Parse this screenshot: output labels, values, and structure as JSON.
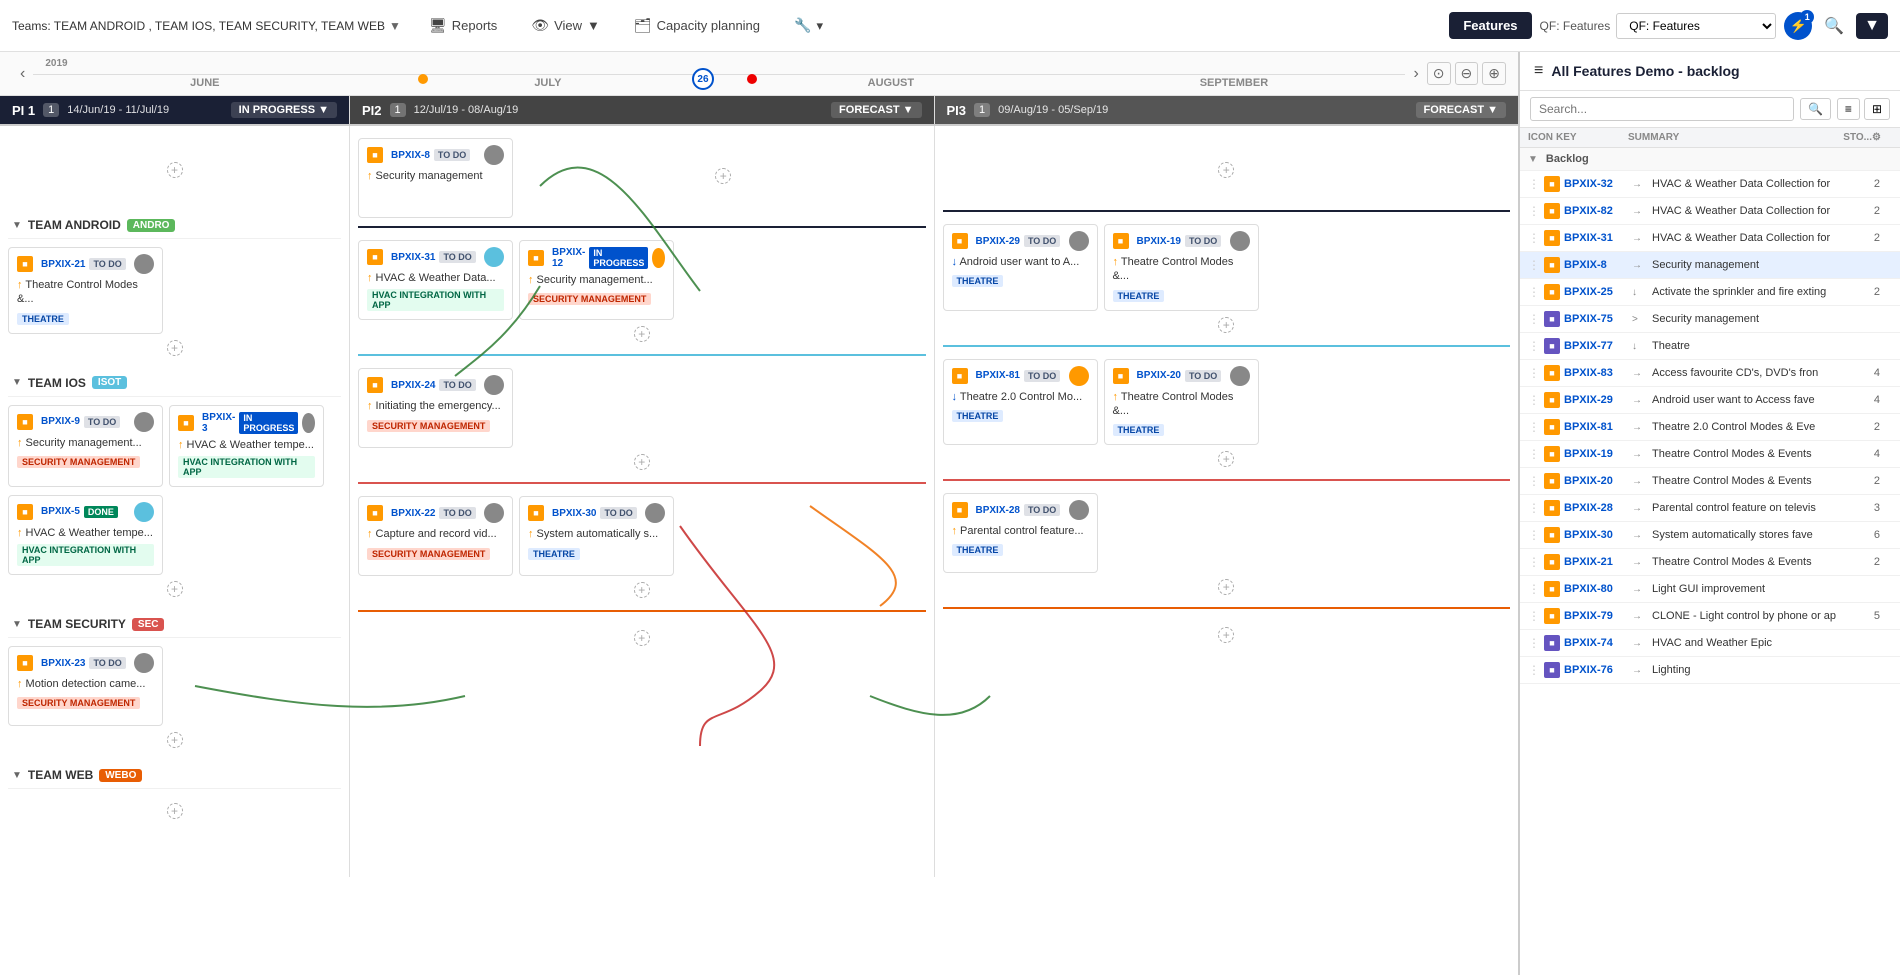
{
  "topbar": {
    "teams_label": "Teams: TEAM ANDROID , TEAM IOS, TEAM SECURITY, TEAM WEB",
    "reports_label": "Reports",
    "view_label": "View",
    "capacity_label": "Capacity planning",
    "features_label": "Features",
    "qf_label": "QF: Features",
    "badge_count": "1",
    "lightning": "⚡",
    "search": "🔍",
    "arrow": "▼"
  },
  "timeline": {
    "prev": "‹",
    "next": "›",
    "months": [
      {
        "label": "JUNE",
        "year": "2019"
      },
      {
        "label": "JULY",
        "year": ""
      },
      {
        "label": "AUGUST",
        "year": ""
      },
      {
        "label": "SEPTEMBER",
        "year": ""
      }
    ],
    "dot26": "26"
  },
  "pi_headers": [
    {
      "id": "PI1",
      "num": "PI 1",
      "dates": "14/Jun/19 - 11/Jul/19",
      "count": "1",
      "status": "IN PROGRESS"
    },
    {
      "id": "PI2",
      "num": "PI2",
      "dates": "12/Jul/19 - 08/Aug/19",
      "count": "1",
      "status": "FORECAST"
    },
    {
      "id": "PI3",
      "num": "PI3",
      "dates": "09/Aug/19 - 05/Sep/19",
      "count": "1",
      "status": "FORECAST"
    }
  ],
  "teams": [
    {
      "name": "TEAM ANDROID",
      "tag": "ANDRO",
      "tag_class": "tag-andro",
      "pi1_cards": [
        {
          "key": "BPXIX-21",
          "status": "TO DO",
          "status_class": "status-todo",
          "title": "Theatre Control Modes &...",
          "label": "THEATRE",
          "label_class": "theatre",
          "avatar_color": "#888",
          "icon": "↑"
        }
      ],
      "pi2_cards": [
        {
          "key": "BPXIX-31",
          "status": "TO DO",
          "status_class": "status-todo",
          "title": "HVAC & Weather Data...",
          "label": "HVAC INTEGRATION WITH APP",
          "label_class": "hvac",
          "avatar_color": "#5bc0de",
          "icon": "↑"
        },
        {
          "key": "BPXIX-12",
          "status": "IN PROGRESS",
          "status_class": "status-inprogress",
          "title": "Security management...",
          "label": "SECURITY MANAGEMENT",
          "label_class": "sec",
          "avatar_color": "#f90",
          "icon": "↑"
        }
      ],
      "pi3_cards": [
        {
          "key": "BPXIX-29",
          "status": "TO DO",
          "status_class": "status-todo",
          "title": "Android user want to A...",
          "label": "THEATRE",
          "label_class": "theatre",
          "avatar_color": "#888",
          "icon": "↓"
        },
        {
          "key": "BPXIX-19",
          "status": "TO DO",
          "status_class": "status-todo",
          "title": "Theatre Control Modes &...",
          "label": "THEATRE",
          "label_class": "theatre",
          "avatar_color": "#888",
          "icon": "↑"
        }
      ]
    },
    {
      "name": "TEAM IOS",
      "tag": "ISOT",
      "tag_class": "tag-isot",
      "pi1_cards": [
        {
          "key": "BPXIX-9",
          "status": "TO DO",
          "status_class": "status-todo",
          "title": "Security management...",
          "label": "SECURITY MANAGEMENT",
          "label_class": "sec",
          "avatar_color": "#888",
          "icon": "↑"
        },
        {
          "key": "BPXIX-3",
          "status": "IN PROGRESS",
          "status_class": "status-inprogress",
          "title": "HVAC & Weather tempe...",
          "label": "HVAC INTEGRATION WITH APP",
          "label_class": "hvac",
          "avatar_color": "#888",
          "icon": "↑"
        },
        {
          "key": "BPXIX-5",
          "status": "DONE",
          "status_class": "status-done",
          "title": "HVAC & Weather tempe...",
          "label": "HVAC INTEGRATION WITH APP",
          "label_class": "hvac",
          "avatar_color": "#5bc0de",
          "icon": "↑"
        }
      ],
      "pi2_cards": [
        {
          "key": "BPXIX-24",
          "status": "TO DO",
          "status_class": "status-todo",
          "title": "Initiating the emergency...",
          "label": "SECURITY MANAGEMENT",
          "label_class": "sec",
          "avatar_color": "#888",
          "icon": "↑"
        }
      ],
      "pi3_cards": [
        {
          "key": "BPXIX-81",
          "status": "TO DO",
          "status_class": "status-todo",
          "title": "Theatre 2.0 Control Mo...",
          "label": "THEATRE",
          "label_class": "theatre",
          "avatar_color": "#f90",
          "icon": "↓"
        },
        {
          "key": "BPXIX-20",
          "status": "TO DO",
          "status_class": "status-todo",
          "title": "Theatre Control Modes &...",
          "label": "THEATRE",
          "label_class": "theatre",
          "avatar_color": "#888",
          "icon": "↑"
        }
      ]
    },
    {
      "name": "TEAM SECURITY",
      "tag": "SEC",
      "tag_class": "tag-sec",
      "pi1_cards": [
        {
          "key": "BPXIX-23",
          "status": "TO DO",
          "status_class": "status-todo",
          "title": "Motion detection came...",
          "label": "SECURITY MANAGEMENT",
          "label_class": "sec",
          "avatar_color": "#888",
          "icon": "↑"
        }
      ],
      "pi2_cards": [
        {
          "key": "BPXIX-22",
          "status": "TO DO",
          "status_class": "status-todo",
          "title": "Capture and record vid...",
          "label": "SECURITY MANAGEMENT",
          "label_class": "sec",
          "avatar_color": "#888",
          "icon": "↑"
        },
        {
          "key": "BPXIX-30",
          "status": "TO DO",
          "status_class": "status-todo",
          "title": "System automatically s...",
          "label": "THEATRE",
          "label_class": "theatre",
          "avatar_color": "#888",
          "icon": "↑"
        }
      ],
      "pi3_cards": [
        {
          "key": "BPXIX-28",
          "status": "TO DO",
          "status_class": "status-todo",
          "title": "Parental control feature...",
          "label": "THEATRE",
          "label_class": "theatre",
          "avatar_color": "#888",
          "icon": "↑"
        }
      ]
    },
    {
      "name": "TEAM WEB",
      "tag": "WEBO",
      "tag_class": "tag-webo",
      "pi1_cards": [],
      "pi2_cards": [],
      "pi3_cards": []
    }
  ],
  "unscheduled_pi2": {
    "key": "BPXIX-8",
    "status": "TO DO",
    "status_class": "status-todo",
    "title": "Security management",
    "avatar_color": "#888",
    "icon": "↑"
  },
  "sidebar": {
    "title": "All Features Demo - backlog",
    "search_placeholder": "Search...",
    "columns": [
      "ICON",
      "KEY",
      "SUMMARY",
      "STO...",
      "⚙"
    ],
    "groups": [
      {
        "type": "group",
        "label": "Backlog",
        "chevron": "▼"
      },
      {
        "type": "row",
        "icon_class": "icon-orange",
        "key": "BPXIX-32",
        "arrow": "→",
        "summary": "HVAC & Weather Data Collection for",
        "sto": "2"
      },
      {
        "type": "row",
        "icon_class": "icon-orange",
        "key": "BPXIX-82",
        "arrow": "→",
        "summary": "HVAC & Weather Data Collection for",
        "sto": "2"
      },
      {
        "type": "row",
        "icon_class": "icon-orange",
        "key": "BPXIX-31",
        "arrow": "→",
        "summary": "HVAC & Weather Data Collection for",
        "sto": "2"
      },
      {
        "type": "row",
        "icon_class": "icon-orange",
        "key": "BPXIX-8",
        "arrow": "→",
        "summary": "Security management",
        "sto": ""
      },
      {
        "type": "row",
        "icon_class": "icon-orange",
        "key": "BPXIX-25",
        "arrow": "↓",
        "summary": "Activate the sprinkler and fire exting",
        "sto": "2"
      },
      {
        "type": "row",
        "icon_class": "icon-purple",
        "key": "BPXIX-75",
        "arrow": ">",
        "summary": "Security management",
        "sto": ""
      },
      {
        "type": "row",
        "icon_class": "icon-purple",
        "key": "BPXIX-77",
        "arrow": "↓",
        "summary": "Theatre",
        "sto": ""
      },
      {
        "type": "row",
        "icon_class": "icon-orange",
        "key": "BPXIX-83",
        "arrow": "→",
        "summary": "Access favourite CD's, DVD's fron",
        "sto": "4"
      },
      {
        "type": "row",
        "icon_class": "icon-orange",
        "key": "BPXIX-29",
        "arrow": "→",
        "summary": "Android user want to Access fave",
        "sto": "4"
      },
      {
        "type": "row",
        "icon_class": "icon-orange",
        "key": "BPXIX-81",
        "arrow": "→",
        "summary": "Theatre 2.0 Control Modes & Eve",
        "sto": "2"
      },
      {
        "type": "row",
        "icon_class": "icon-orange",
        "key": "BPXIX-19",
        "arrow": "→",
        "summary": "Theatre Control Modes & Events",
        "sto": "4"
      },
      {
        "type": "row",
        "icon_class": "icon-orange",
        "key": "BPXIX-20",
        "arrow": "→",
        "summary": "Theatre Control Modes & Events",
        "sto": "2"
      },
      {
        "type": "row",
        "icon_class": "icon-orange",
        "key": "BPXIX-28",
        "arrow": "→",
        "summary": "Parental control feature on televis",
        "sto": "3"
      },
      {
        "type": "row",
        "icon_class": "icon-orange",
        "key": "BPXIX-30",
        "arrow": "→",
        "summary": "System automatically stores fave",
        "sto": "6"
      },
      {
        "type": "row",
        "icon_class": "icon-orange",
        "key": "BPXIX-21",
        "arrow": "→",
        "summary": "Theatre Control Modes & Events",
        "sto": "2"
      },
      {
        "type": "row",
        "icon_class": "icon-orange",
        "key": "BPXIX-80",
        "arrow": "→",
        "summary": "Light GUI improvement",
        "sto": ""
      },
      {
        "type": "row",
        "icon_class": "icon-orange",
        "key": "BPXIX-79",
        "arrow": "→",
        "summary": "CLONE - Light control by phone or ap",
        "sto": "5"
      },
      {
        "type": "row",
        "icon_class": "icon-purple",
        "key": "BPXIX-74",
        "arrow": "→",
        "summary": "HVAC and Weather Epic",
        "sto": ""
      },
      {
        "type": "row",
        "icon_class": "icon-purple",
        "key": "BPXIX-76",
        "arrow": "→",
        "summary": "Lighting",
        "sto": ""
      }
    ]
  }
}
